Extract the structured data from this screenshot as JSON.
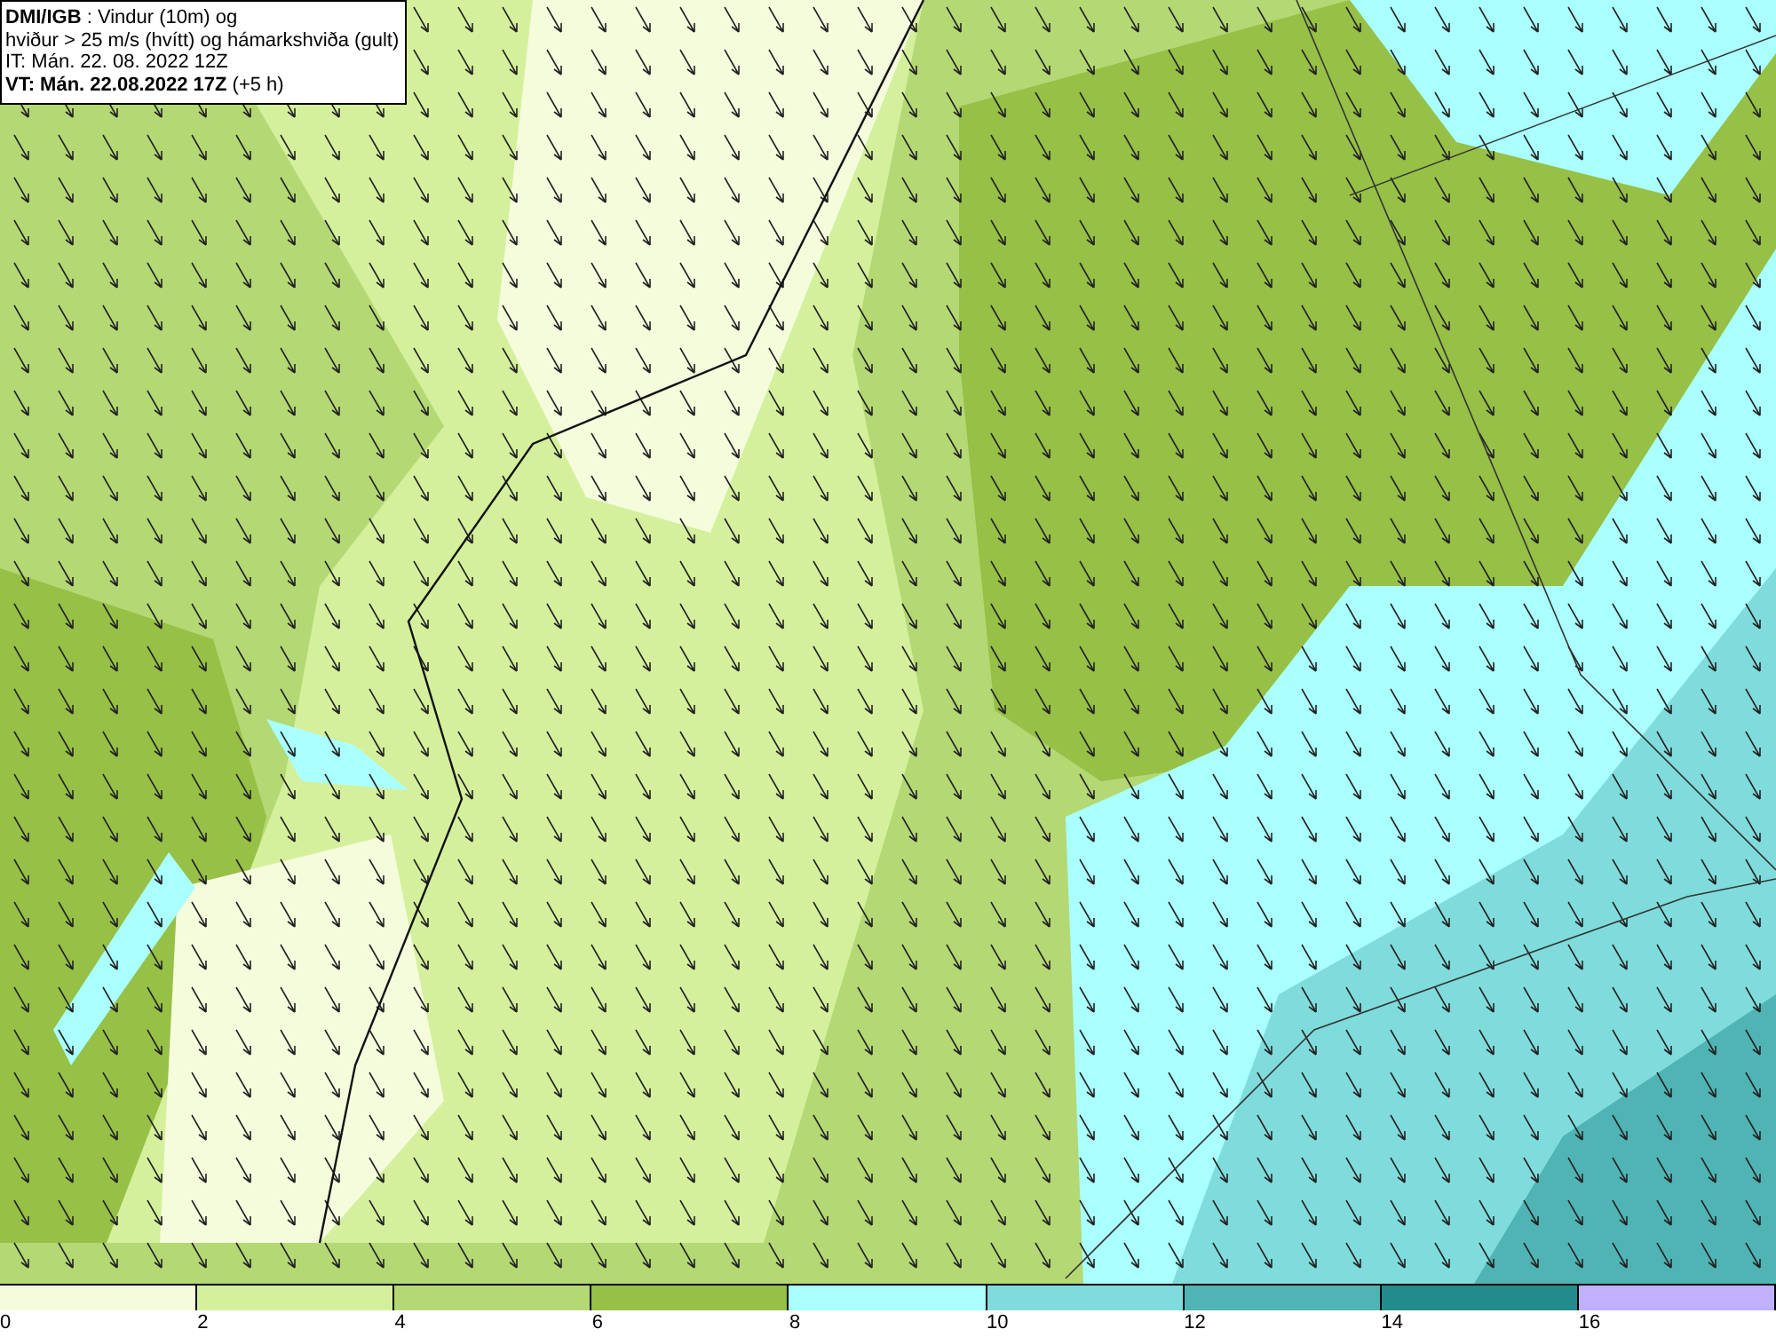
{
  "header": {
    "lines": [
      "**DMI/IGB** : Vindur (10m) og",
      "hviður > 25 m/s (hvítt) og hámarkshviða (gult)",
      "IT: Mán. 22. 08. 2022 12Z",
      "**VT: Mán. 22.08.2022 17Z** (+5 h)"
    ]
  },
  "legend": [
    {
      "label": "0",
      "color": "#f4fcdc"
    },
    {
      "label": "2",
      "color": "#d4f09c"
    },
    {
      "label": "4",
      "color": "#b4d874"
    },
    {
      "label": "6",
      "color": "#96c046"
    },
    {
      "label": "8",
      "color": "#aaffff"
    },
    {
      "label": "10",
      "color": "#80dcdc"
    },
    {
      "label": "12",
      "color": "#50b4b4"
    },
    {
      "label": "14",
      "color": "#228c8c"
    },
    {
      "label": "16",
      "color": "#c0b0ff"
    }
  ]
}
